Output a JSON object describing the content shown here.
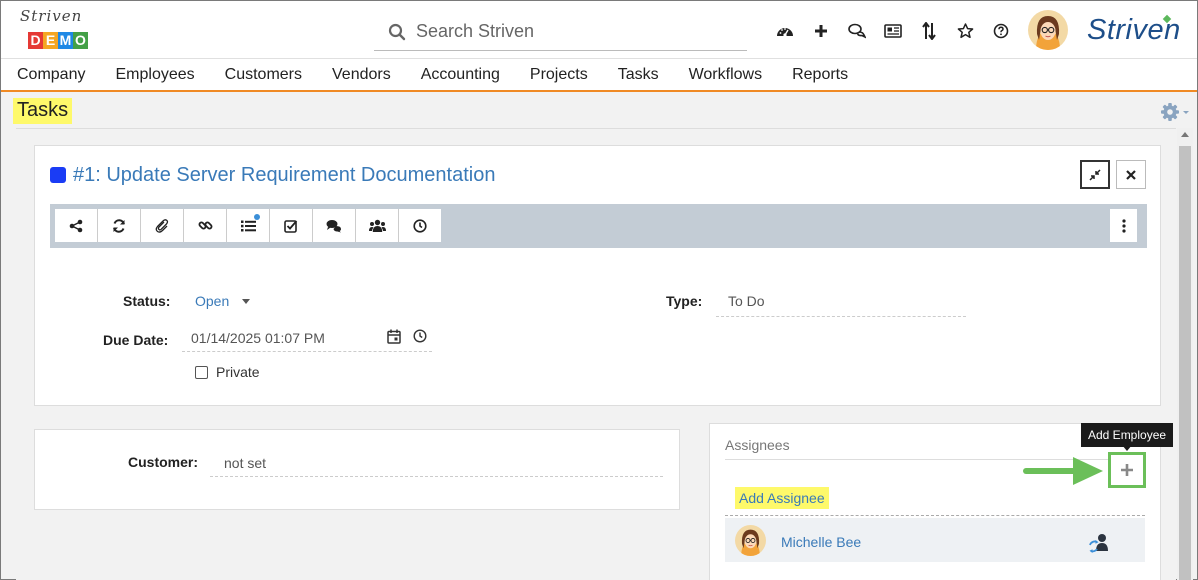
{
  "header": {
    "logo_script": "Striven",
    "logo_demo_letters": [
      "D",
      "E",
      "M",
      "O"
    ],
    "logo_demo_colors": [
      "#e53935",
      "#f5a623",
      "#1e88e5",
      "#43a047"
    ],
    "search_placeholder": "Search Striven",
    "icons": [
      "dashboard-icon",
      "plus-icon",
      "chat-icon",
      "news-icon",
      "sort-icon",
      "star-icon",
      "help-icon"
    ],
    "brand": "Striven"
  },
  "nav": {
    "items": [
      "Company",
      "Employees",
      "Customers",
      "Vendors",
      "Accounting",
      "Projects",
      "Tasks",
      "Workflows",
      "Reports"
    ]
  },
  "page": {
    "title": "Tasks"
  },
  "task": {
    "title": "#1: Update Server Requirement Documentation",
    "color": "#1a3cf5",
    "toolbar_icons": [
      "share-icon",
      "refresh-icon",
      "paperclip-icon",
      "link-icon",
      "list-icon",
      "checklist-icon",
      "comments-icon",
      "team-icon",
      "clock-icon"
    ],
    "status_label": "Status:",
    "status_value": "Open",
    "type_label": "Type:",
    "type_value": "To Do",
    "due_label": "Due Date:",
    "due_value": "01/14/2025 01:07 PM",
    "private_label": "Private"
  },
  "customer": {
    "label": "Customer:",
    "value": "not set"
  },
  "assignees": {
    "heading": "Assignees",
    "add_label": "Add Assignee",
    "tooltip": "Add Employee",
    "people": [
      {
        "name": "Michelle Bee"
      }
    ]
  },
  "colors": {
    "accent_orange": "#f08a24",
    "link_blue": "#3a7ab8",
    "highlight_yellow": "#fef96a",
    "callout_green": "#6bbf59"
  }
}
